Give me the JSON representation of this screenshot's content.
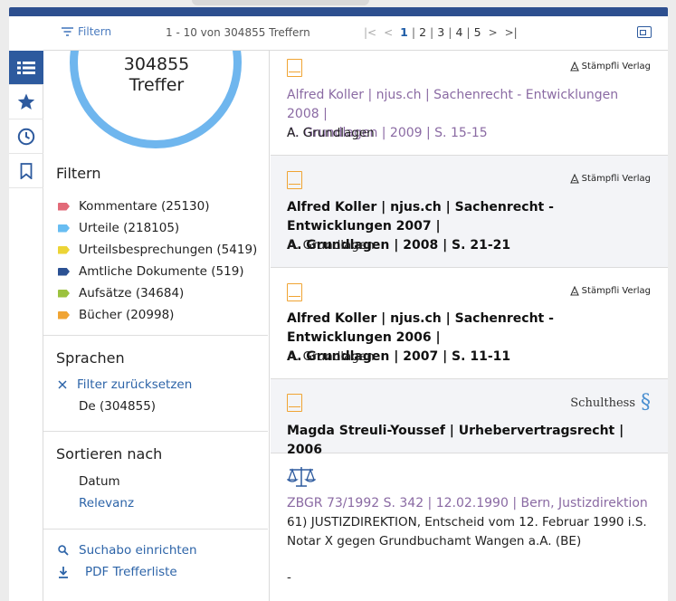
{
  "toolbar": {
    "filter_label": "Filtern",
    "result_range": "1 - 10 von 304855 Treffern",
    "pager": {
      "first": "|<",
      "prev": "<",
      "pages": [
        "1",
        "2",
        "3",
        "4",
        "5"
      ],
      "active_page": "1",
      "next": ">",
      "last": ">|"
    }
  },
  "summary": {
    "count": "304855",
    "label": "Treffer",
    "ring_color": "#6fb6ee"
  },
  "filters": {
    "title": "Filtern",
    "categories": [
      {
        "label": "Kommentare (25130)",
        "color": "#e26a78"
      },
      {
        "label": "Urteile (218105)",
        "color": "#68bdf2"
      },
      {
        "label": "Urteilsbesprechungen (5419)",
        "color": "#ecd436"
      },
      {
        "label": "Amtliche Dokumente (519)",
        "color": "#2b5193"
      },
      {
        "label": "Aufsätze (34684)",
        "color": "#9cc23f"
      },
      {
        "label": "Bücher (20998)",
        "color": "#f0a433"
      }
    ]
  },
  "languages": {
    "title": "Sprachen",
    "reset": "Filter zurücksetzen",
    "items": [
      "De (304855)"
    ]
  },
  "sort": {
    "title": "Sortieren nach",
    "options": [
      "Datum",
      "Relevanz"
    ]
  },
  "actions": {
    "subscribe": "Suchabo einrichten",
    "pdf": "PDF Trefferliste"
  },
  "results": [
    {
      "publisher": "Stämpfli Verlag",
      "title_line1": "Alfred Koller | njus.ch | Sachenrecht - Entwicklungen 2008 |",
      "title_line2": "A. Grundlagen | 2009 | S. 15-15",
      "subtitle": "A. Grundlagen"
    },
    {
      "publisher": "Stämpfli Verlag",
      "title_line1": "Alfred Koller | njus.ch | Sachenrecht - Entwicklungen 2007 |",
      "title_line2": "A. Grundlagen | 2008 | S. 21-21",
      "subtitle": "A. Grundlagen"
    },
    {
      "publisher": "Stämpfli Verlag",
      "title_line1": "Alfred Koller | njus.ch | Sachenrecht - Entwicklungen 2006 |",
      "title_line2": "A. Grundlagen | 2007 | S. 11-11",
      "subtitle": "A. Grundlagen"
    },
    {
      "publisher": "Schulthess",
      "publisher_mark": "§",
      "title_line1": "Magda Streuli-Youssef | Urhebervertragsrecht | 2006"
    },
    {
      "title_line1": "ZBGR 73/1992 S. 342 | 12.02.1990 | Bern, Justizdirektion",
      "text_line1": "61) JUSTIZDIREKTION, Entscheid vom 12. Februar 1990 i.S.",
      "text_line2": "Notar X gegen Grundbuchamt Wangen a.A. (BE)",
      "text_line3": "-"
    }
  ]
}
